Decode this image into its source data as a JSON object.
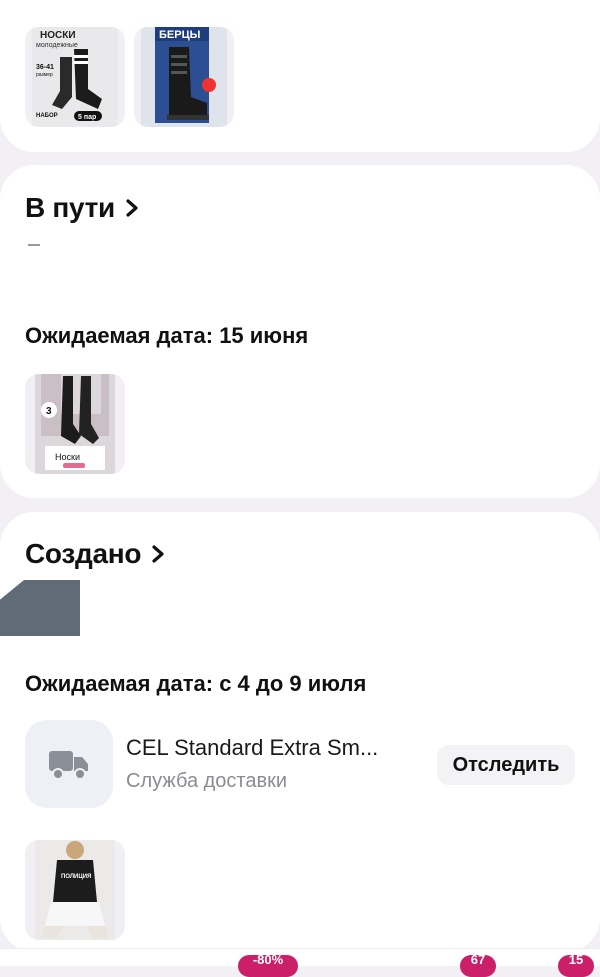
{
  "transit": {
    "title": "В пути",
    "expected_date": "Ожидаемая дата: 15 июня"
  },
  "created": {
    "title": "Создано",
    "expected_date": "Ожидаемая дата: с 4 до 9 июля",
    "carrier_name": "CEL Standard Extra Sm...",
    "carrier_sub": "Служба доставки",
    "track_label": "Отследить"
  },
  "thumbs": {
    "socks_pack": [
      "НОСКИ",
      "молодежные",
      "36-41",
      "размер",
      "НАБОР",
      "5 пар"
    ],
    "boots": "БЕРЦЫ",
    "socks_single": "Носки",
    "tshirt": "ПОЛИЦИЯ"
  },
  "bottom_badges": [
    "-80%",
    "67",
    "15"
  ],
  "colors": {
    "accent": "#cb1f6a",
    "background": "#f2eff5",
    "card": "#ffffff",
    "muted": "#8b8b93"
  }
}
